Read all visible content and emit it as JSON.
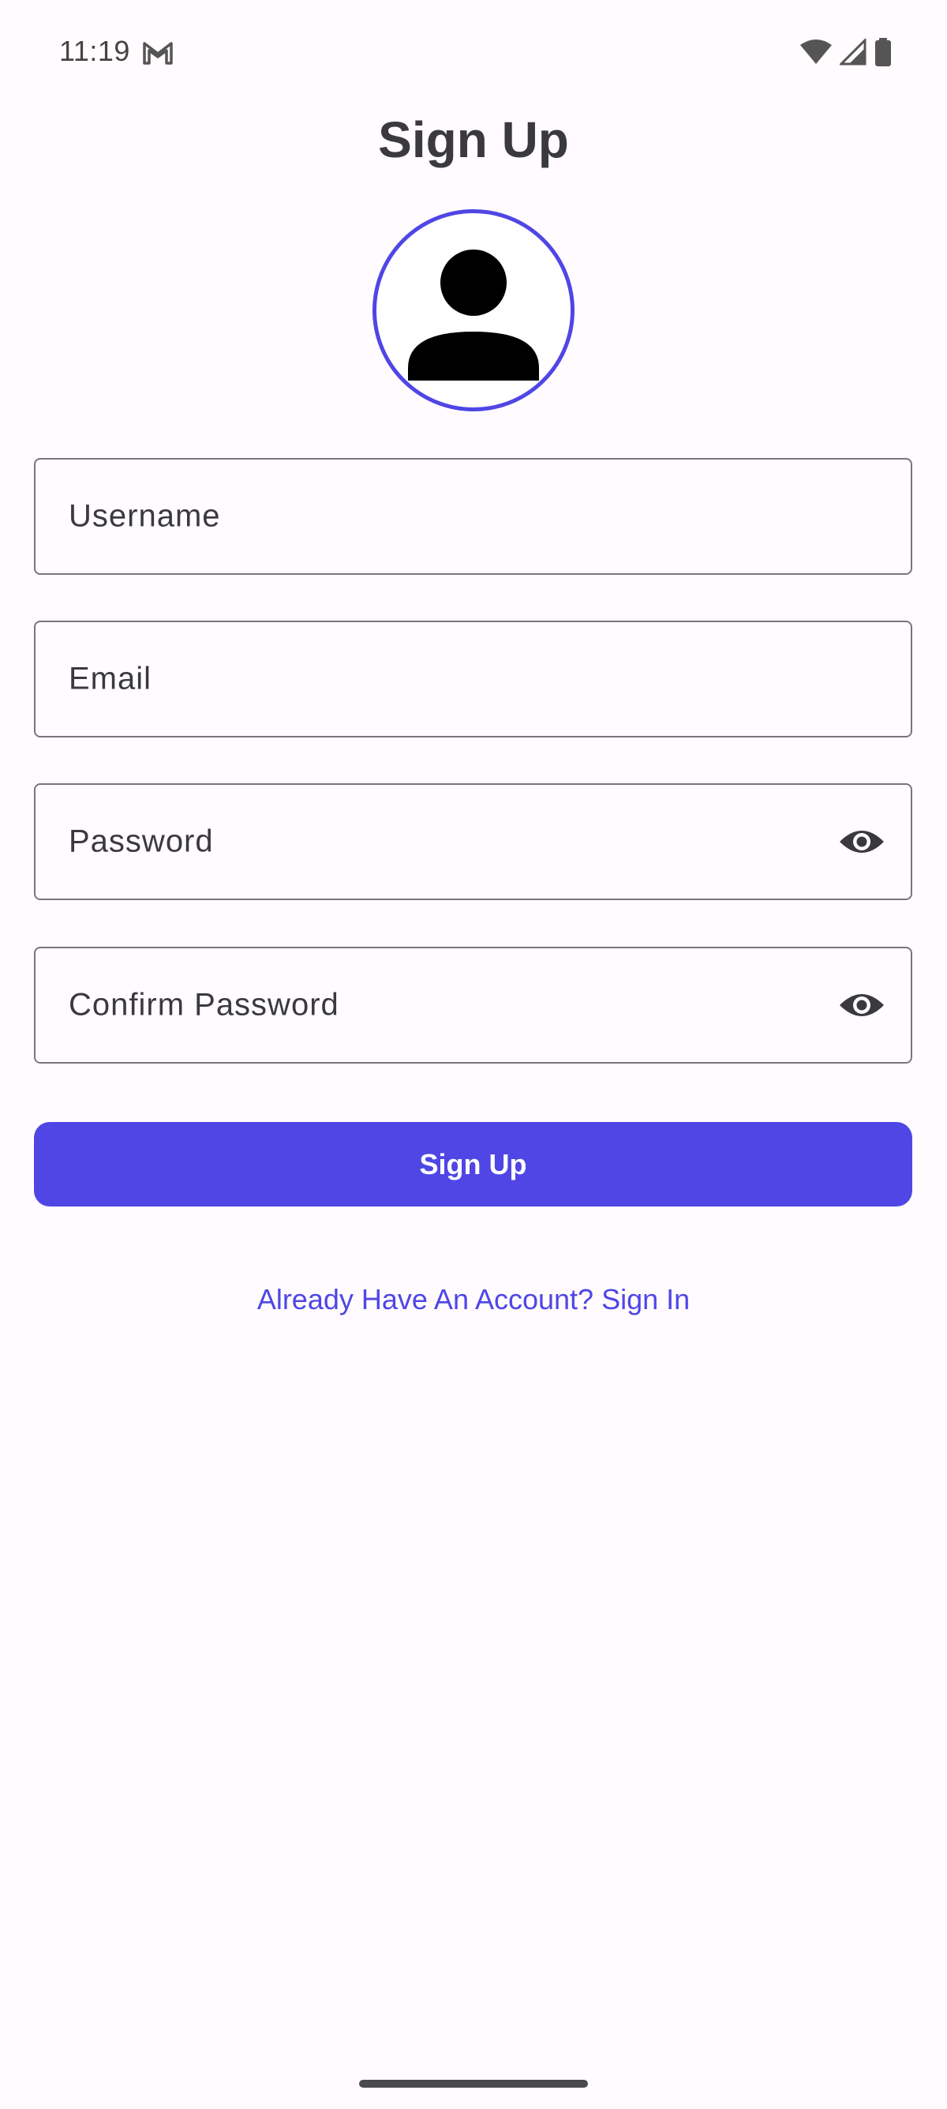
{
  "status_bar": {
    "time": "11:19",
    "notification_icon": "gmail-icon",
    "wifi_icon": "wifi-icon",
    "signal_icon": "cell-signal-icon",
    "battery_icon": "battery-icon"
  },
  "page": {
    "title": "Sign Up"
  },
  "avatar": {
    "icon": "person-icon",
    "border_color": "#4F46E5"
  },
  "form": {
    "username": {
      "placeholder": "Username",
      "value": ""
    },
    "email": {
      "placeholder": "Email",
      "value": ""
    },
    "password": {
      "placeholder": "Password",
      "value": "",
      "toggle_icon": "eye-icon"
    },
    "confirm_password": {
      "placeholder": "Confirm Password",
      "value": "",
      "toggle_icon": "eye-icon"
    }
  },
  "actions": {
    "signup_label": "Sign Up",
    "signin_link": "Already Have An Account? Sign In"
  },
  "colors": {
    "accent": "#4F46E5",
    "background": "#FFFBFE",
    "outline": "#79747E",
    "text": "#3A3A3E"
  }
}
